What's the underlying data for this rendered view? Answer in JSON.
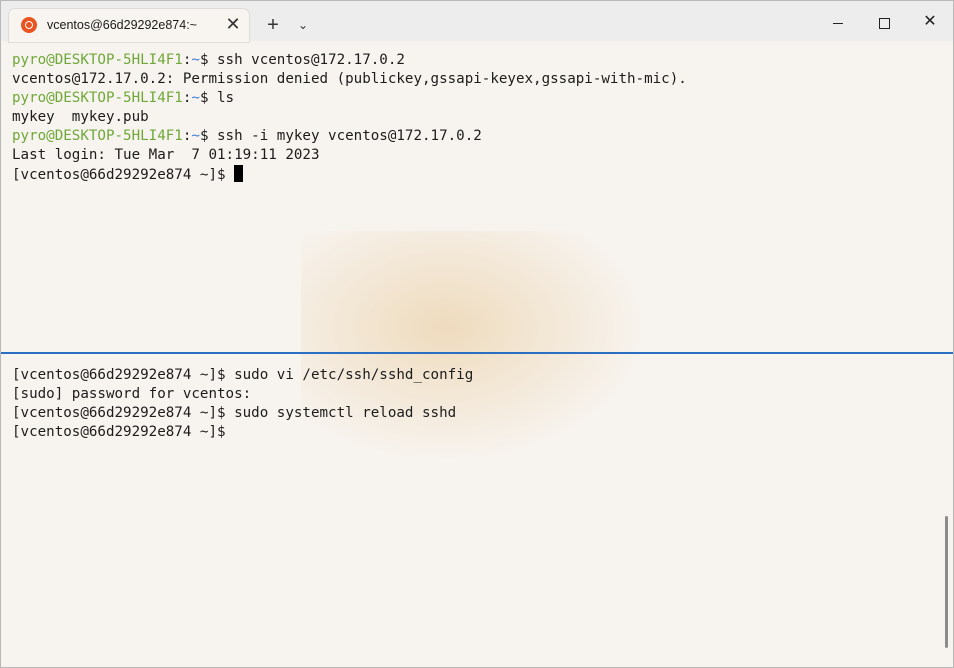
{
  "window": {
    "tab_title": "vcentos@66d29292e874:~",
    "tab_close": "✕",
    "new_tab": "+",
    "dropdown": "⌄",
    "close_glyph": "✕",
    "accent_color": "#2b6fc2",
    "prompt_user_color": "#6fa839",
    "prompt_path_color": "#3c7fd8"
  },
  "top_pane": {
    "lines": [
      {
        "user": "pyro@DESKTOP-5HLI4F1",
        "sep": ":",
        "path": "~",
        "rest": "$ ssh vcentos@172.17.0.2"
      },
      {
        "text": "vcentos@172.17.0.2: Permission denied (publickey,gssapi-keyex,gssapi-with-mic)."
      },
      {
        "user": "pyro@DESKTOP-5HLI4F1",
        "sep": ":",
        "path": "~",
        "rest": "$ ls"
      },
      {
        "text": "mykey  mykey.pub"
      },
      {
        "user": "pyro@DESKTOP-5HLI4F1",
        "sep": ":",
        "path": "~",
        "rest": "$ ssh -i mykey vcentos@172.17.0.2"
      },
      {
        "text": "Last login: Tue Mar  7 01:19:11 2023"
      },
      {
        "text": "[vcentos@66d29292e874 ~]$ "
      }
    ]
  },
  "bottom_pane": {
    "lines": [
      {
        "text": "[vcentos@66d29292e874 ~]$ sudo vi /etc/ssh/sshd_config"
      },
      {
        "text": "[sudo] password for vcentos:"
      },
      {
        "text": "[vcentos@66d29292e874 ~]$ sudo systemctl reload sshd"
      },
      {
        "text": "[vcentos@66d29292e874 ~]$"
      }
    ]
  }
}
